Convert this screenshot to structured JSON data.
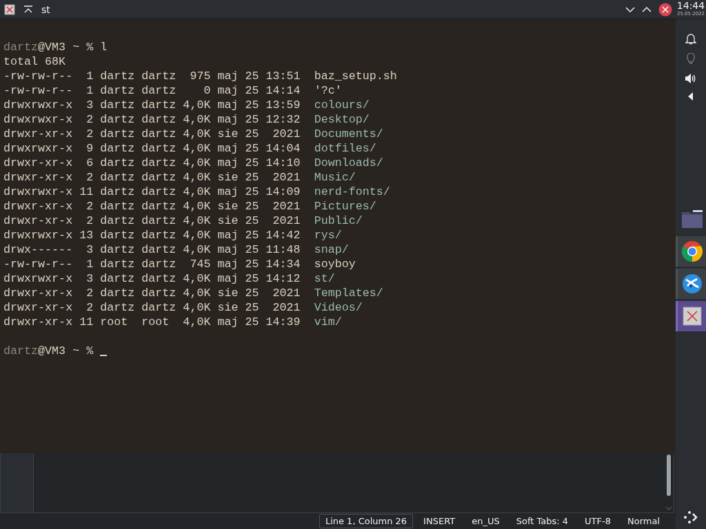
{
  "window": {
    "title": "st"
  },
  "clock": {
    "time": "14:44",
    "date": "25.05.2022"
  },
  "terminal": {
    "prompts": [
      {
        "user": "dartz",
        "rest": "@VM3 ~ % ",
        "command": "l"
      }
    ],
    "total": "total 68K",
    "listing": [
      {
        "meta": "-rw-rw-r--  1 dartz dartz  975 maj 25 13:51",
        "name": "baz_setup.sh",
        "kind": "file"
      },
      {
        "meta": "-rw-rw-r--  1 dartz dartz    0 maj 25 14:14",
        "name": "'?c'",
        "kind": "file"
      },
      {
        "meta": "drwxrwxr-x  3 dartz dartz 4,0K maj 25 13:59",
        "name": "colours/",
        "kind": "dir"
      },
      {
        "meta": "drwxrwxr-x  2 dartz dartz 4,0K maj 25 12:32",
        "name": "Desktop/",
        "kind": "dir"
      },
      {
        "meta": "drwxr-xr-x  2 dartz dartz 4,0K sie 25  2021",
        "name": "Documents/",
        "kind": "dir"
      },
      {
        "meta": "drwxrwxr-x  9 dartz dartz 4,0K maj 25 14:04",
        "name": "dotfiles/",
        "kind": "dir"
      },
      {
        "meta": "drwxr-xr-x  6 dartz dartz 4,0K maj 25 14:10",
        "name": "Downloads/",
        "kind": "dir"
      },
      {
        "meta": "drwxr-xr-x  2 dartz dartz 4,0K sie 25  2021",
        "name": "Music/",
        "kind": "dir"
      },
      {
        "meta": "drwxrwxr-x 11 dartz dartz 4,0K maj 25 14:09",
        "name": "nerd-fonts/",
        "kind": "dir"
      },
      {
        "meta": "drwxr-xr-x  2 dartz dartz 4,0K sie 25  2021",
        "name": "Pictures/",
        "kind": "dir"
      },
      {
        "meta": "drwxr-xr-x  2 dartz dartz 4,0K sie 25  2021",
        "name": "Public/",
        "kind": "dir"
      },
      {
        "meta": "drwxrwxr-x 13 dartz dartz 4,0K maj 25 14:42",
        "name": "rys/",
        "kind": "dir"
      },
      {
        "meta": "drwx------  3 dartz dartz 4,0K maj 25 11:48",
        "name": "snap/",
        "kind": "dir"
      },
      {
        "meta": "-rw-rw-r--  1 dartz dartz  745 maj 25 14:34",
        "name": "soyboy",
        "kind": "file"
      },
      {
        "meta": "drwxrwxr-x  3 dartz dartz 4,0K maj 25 14:12",
        "name": "st/",
        "kind": "dir"
      },
      {
        "meta": "drwxr-xr-x  2 dartz dartz 4,0K sie 25  2021",
        "name": "Templates/",
        "kind": "dir"
      },
      {
        "meta": "drwxr-xr-x  2 dartz dartz 4,0K sie 25  2021",
        "name": "Videos/",
        "kind": "dir"
      },
      {
        "meta": "drwxr-xr-x 11 root  root  4,0K maj 25 14:39",
        "name": "vim/",
        "kind": "dir"
      }
    ],
    "final_prompt": {
      "user": "dartz",
      "rest": "@VM3 ~ %"
    }
  },
  "tasks": [
    {
      "kind": "folder",
      "selected": false
    },
    {
      "kind": "browser",
      "selected": false
    },
    {
      "kind": "bird",
      "selected": false
    },
    {
      "kind": "terminal",
      "selected": true
    }
  ],
  "status_bar": [
    {
      "label": "Line 1, Column 26",
      "highlighted": true
    },
    {
      "label": "INSERT",
      "highlighted": false
    },
    {
      "label": "en_US",
      "highlighted": false
    },
    {
      "label": "Soft Tabs: 4",
      "highlighted": false
    },
    {
      "label": "UTF-8",
      "highlighted": false
    },
    {
      "label": "Normal",
      "highlighted": false
    }
  ]
}
